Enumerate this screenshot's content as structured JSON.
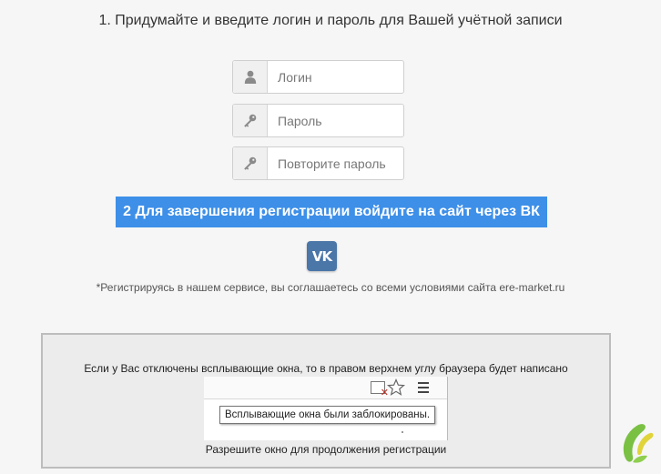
{
  "step1": {
    "title": "1. Придумайте и введите логин и пароль для Вашей учётной записи"
  },
  "form": {
    "login_placeholder": "Логин",
    "password_placeholder": "Пароль",
    "repeat_password_placeholder": "Повторите пароль"
  },
  "step2": {
    "title": "2 Для завершения регистрации войдите на сайт через ВК"
  },
  "vk_button": {
    "label": "VK"
  },
  "terms": {
    "text": "*Регистрируясь в нашем сервисе, вы соглашаетесь со всеми условиями сайта ere-market.ru"
  },
  "popup_notice": {
    "message": "Если у Вас отключены всплывающие окна, то в правом верхнем углу браузера будет написано",
    "tooltip": "Всплывающие окна были заблокированы.",
    "allow_text": "Разрешите окно для продолжения регистрации"
  },
  "colors": {
    "accent": "#3d8fe8",
    "vk": "#4a76a8",
    "logo_green": "#7ac143",
    "logo_yellow": "#e0d43a"
  },
  "icons": [
    "user-icon",
    "key-icon",
    "key-icon",
    "vk-logo-icon",
    "popup-blocked-icon",
    "star-icon",
    "menu-icon",
    "brand-logo-icon"
  ]
}
